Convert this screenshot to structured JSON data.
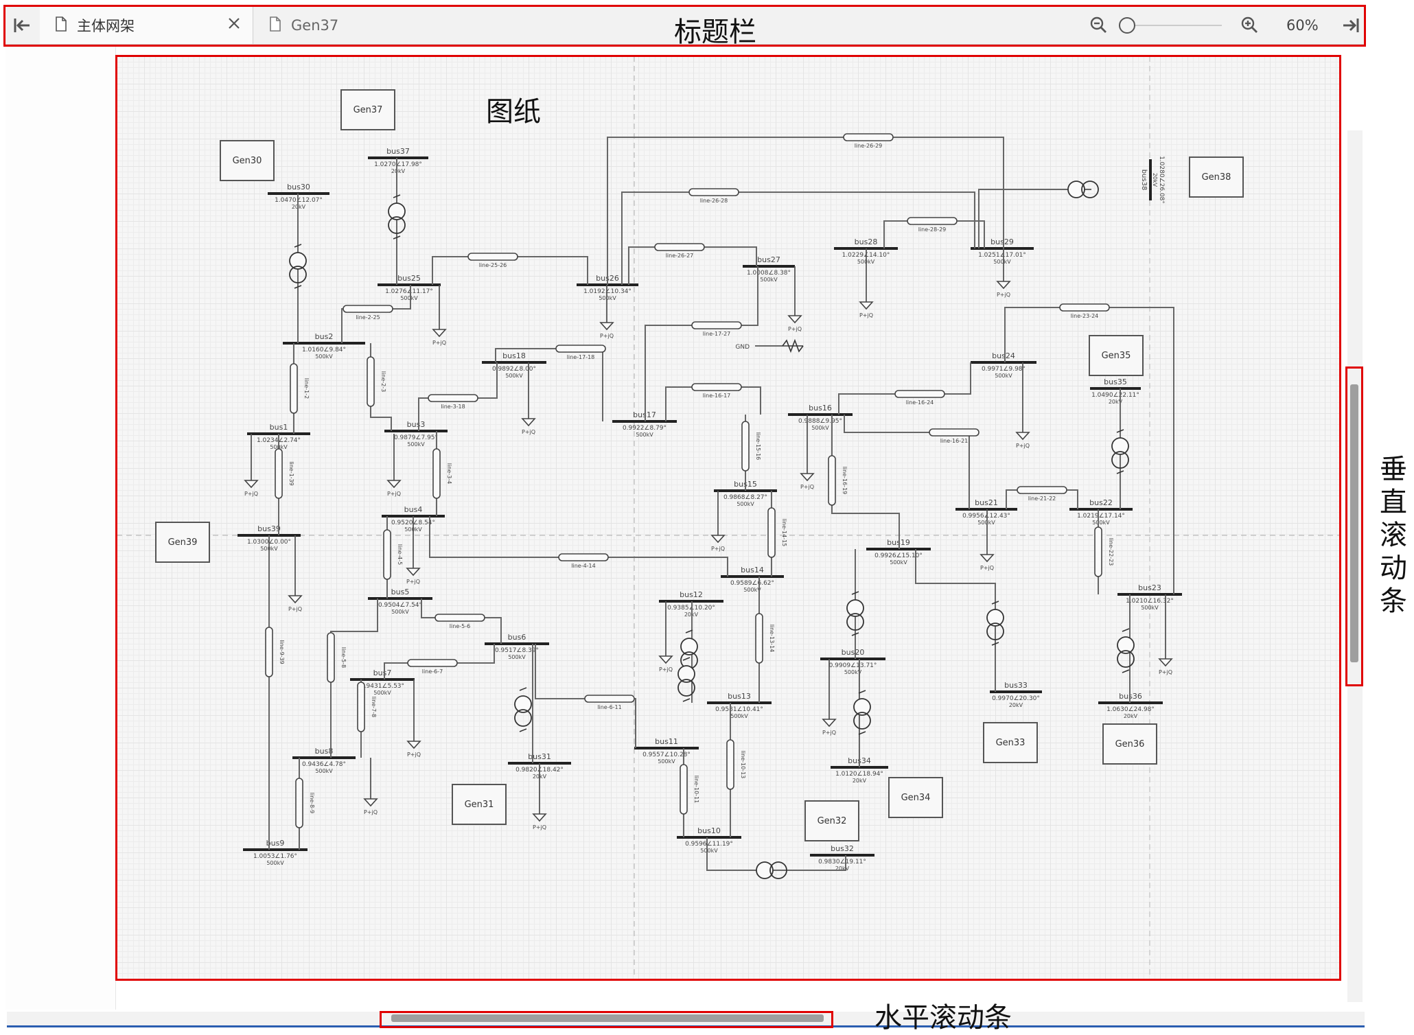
{
  "tabs": [
    {
      "label": "主体网架",
      "icon": "file-icon",
      "closable": true
    },
    {
      "label": "Gen37",
      "icon": "file-icon",
      "closable": false
    }
  ],
  "toolbar": {
    "zoom_percent": "60%",
    "zoom_level": 0.0
  },
  "annotations": {
    "title_bar": "标题栏",
    "drawing": "图纸",
    "vertical_scrollbar": "垂直滚动条",
    "horizontal_scrollbar": "水平滚动条"
  },
  "diagram": {
    "generators": [
      "Gen37",
      "Gen30",
      "Gen38",
      "Gen35",
      "Gen39",
      "Gen33",
      "Gen36",
      "Gen31",
      "Gen34",
      "Gen32"
    ],
    "buses": [
      {
        "name": "bus37",
        "value": "1.0270∠17.98°",
        "kv": "20kV"
      },
      {
        "name": "bus30",
        "value": "1.0470∠12.07°",
        "kv": "20kV"
      },
      {
        "name": "bus25",
        "value": "1.0276∠11.17°",
        "kv": "500kV"
      },
      {
        "name": "bus26",
        "value": "1.0192∠10.34°",
        "kv": "500kV"
      },
      {
        "name": "bus27",
        "value": "1.0008∠8.38°",
        "kv": "500kV"
      },
      {
        "name": "bus28",
        "value": "1.0229∠14.10°",
        "kv": "500kV"
      },
      {
        "name": "bus29",
        "value": "1.0251∠17.01°",
        "kv": "500kV"
      },
      {
        "name": "bus38",
        "value": "1.0280∠26.08°",
        "kv": "20kV"
      },
      {
        "name": "bus2",
        "value": "1.0160∠9.84°",
        "kv": "500kV"
      },
      {
        "name": "bus18",
        "value": "0.9892∠8.00°",
        "kv": "500kV"
      },
      {
        "name": "bus17",
        "value": "0.9922∠8.79°",
        "kv": "500kV"
      },
      {
        "name": "bus16",
        "value": "0.9888∠9.95°",
        "kv": "500kV"
      },
      {
        "name": "bus24",
        "value": "0.9971∠9.98°",
        "kv": "500kV"
      },
      {
        "name": "bus35",
        "value": "1.0490∠22.11°",
        "kv": "20kV"
      },
      {
        "name": "bus1",
        "value": "1.0234∠2.74°",
        "kv": "500kV"
      },
      {
        "name": "bus3",
        "value": "0.9879∠7.95°",
        "kv": "500kV"
      },
      {
        "name": "bus15",
        "value": "0.9868∠8.27°",
        "kv": "500kV"
      },
      {
        "name": "bus21",
        "value": "0.9956∠12.43°",
        "kv": "500kV"
      },
      {
        "name": "bus22",
        "value": "1.0219∠17.14°",
        "kv": "500kV"
      },
      {
        "name": "bus39",
        "value": "1.0300∠0.00°",
        "kv": "500kV"
      },
      {
        "name": "bus4",
        "value": "0.9520∠8.54°",
        "kv": "500kV"
      },
      {
        "name": "bus19",
        "value": "0.9926∠15.10°",
        "kv": "500kV"
      },
      {
        "name": "bus14",
        "value": "0.9589∠6.62°",
        "kv": "500kV"
      },
      {
        "name": "bus23",
        "value": "1.0210∠16.32°",
        "kv": "500kV"
      },
      {
        "name": "bus5",
        "value": "0.9504∠7.54°",
        "kv": "500kV"
      },
      {
        "name": "bus12",
        "value": "0.9385∠10.20°",
        "kv": "20kV"
      },
      {
        "name": "bus6",
        "value": "0.9517∠8.39°",
        "kv": "500kV"
      },
      {
        "name": "bus20",
        "value": "0.9909∠13.71°",
        "kv": "500kV"
      },
      {
        "name": "bus7",
        "value": "0.9431∠5.53°",
        "kv": "500kV"
      },
      {
        "name": "bus33",
        "value": "0.9970∠20.30°",
        "kv": "20kV"
      },
      {
        "name": "bus13",
        "value": "0.9581∠10.41°",
        "kv": "500kV"
      },
      {
        "name": "bus36",
        "value": "1.0630∠24.98°",
        "kv": "20kV"
      },
      {
        "name": "bus8",
        "value": "0.9436∠4.78°",
        "kv": "500kV"
      },
      {
        "name": "bus11",
        "value": "0.9557∠10.28°",
        "kv": "500kV"
      },
      {
        "name": "bus31",
        "value": "0.9820∠18.42°",
        "kv": "20kV"
      },
      {
        "name": "bus34",
        "value": "1.0120∠18.94°",
        "kv": "20kV"
      },
      {
        "name": "bus10",
        "value": "0.9596∠11.19°",
        "kv": "500kV"
      },
      {
        "name": "bus9",
        "value": "1.0053∠1.76°",
        "kv": "500kV"
      },
      {
        "name": "bus32",
        "value": "0.9830∠19.11°",
        "kv": "20kV"
      }
    ],
    "lines": [
      "line-26-29",
      "line-26-28",
      "line-28-29",
      "line-25-26",
      "line-26-27",
      "line-2-25",
      "line-17-27",
      "line-17-18",
      "line-3-18",
      "line-16-17",
      "line-16-24",
      "line-23-24",
      "line-1-2",
      "line-2-3",
      "line-16-21",
      "line-15-16",
      "line-16-19",
      "line-3-4",
      "line-1-39",
      "line-21-22",
      "line-14-15",
      "line-22-23",
      "line-4-5",
      "line-4-14",
      "line-13-14",
      "line-5-6",
      "line-5-8",
      "line-6-7",
      "line-9-39",
      "line-7-8",
      "line-6-11",
      "line-10-13",
      "line-10-11",
      "line-8-9"
    ],
    "load_label": "P+jQ",
    "ground_label": "GND"
  }
}
